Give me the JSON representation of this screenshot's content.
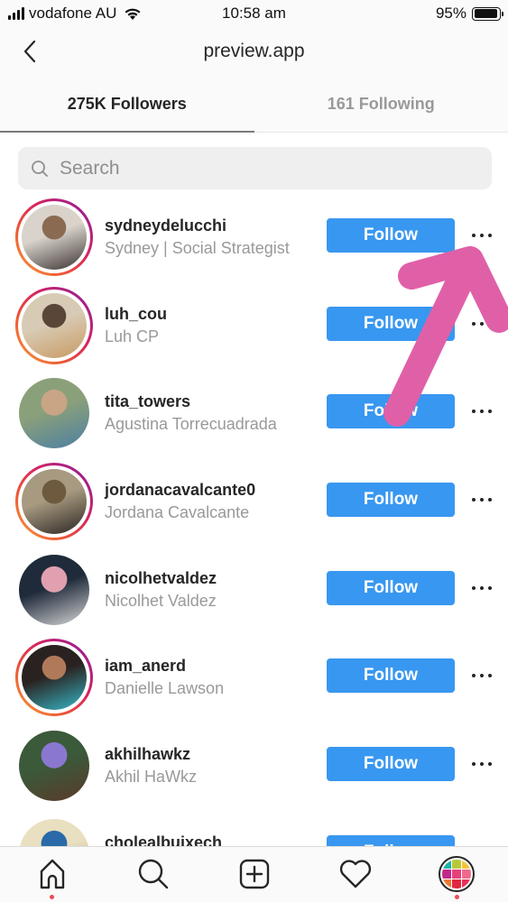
{
  "status_bar": {
    "carrier": "vodafone AU",
    "time": "10:58 am",
    "battery": "95%",
    "battery_level": 0.95
  },
  "nav": {
    "title": "preview.app",
    "back_icon": "chevron-left-icon"
  },
  "tabs": [
    {
      "label": "275K Followers",
      "active": true
    },
    {
      "label": "161 Following",
      "active": false
    }
  ],
  "search": {
    "placeholder": "Search",
    "value": "",
    "icon": "search-icon"
  },
  "follow_label": "Follow",
  "users": [
    {
      "username": "sydneydelucchi",
      "full_name": "Sydney | Social Strategist",
      "has_story": true,
      "avatar_colors": [
        "#d9d3cc",
        "#8a6b52",
        "#3a3230"
      ]
    },
    {
      "username": "luh_cou",
      "full_name": "Luh CP",
      "has_story": true,
      "avatar_colors": [
        "#d8cbb5",
        "#5a4638",
        "#c99a62"
      ]
    },
    {
      "username": "tita_towers",
      "full_name": "Agustina Torrecuadrada",
      "has_story": false,
      "avatar_colors": [
        "#8aa07a",
        "#c9a586",
        "#4c7fa3"
      ]
    },
    {
      "username": "jordanacavalcante0",
      "full_name": "Jordana Cavalcante",
      "has_story": true,
      "avatar_colors": [
        "#a79a80",
        "#6e5a3e",
        "#2c2622"
      ]
    },
    {
      "username": "nicolhetvaldez",
      "full_name": "Nicolhet Valdez",
      "has_story": false,
      "avatar_colors": [
        "#1f2a3a",
        "#e0a0b0",
        "#d8d8d8"
      ]
    },
    {
      "username": "iam_anerd",
      "full_name": "Danielle Lawson",
      "has_story": true,
      "avatar_colors": [
        "#2a2220",
        "#b07a5a",
        "#37b8c8"
      ]
    },
    {
      "username": "akhilhawkz",
      "full_name": "Akhil HaWkz",
      "has_story": false,
      "avatar_colors": [
        "#3a5a3a",
        "#8a78d0",
        "#5a3a2a"
      ]
    },
    {
      "username": "cholealbuixech",
      "full_name": "",
      "has_story": false,
      "avatar_colors": [
        "#e8e0c0",
        "#2a6aa8",
        "#c09070"
      ]
    }
  ],
  "bottom_nav": [
    {
      "name": "home",
      "icon": "home-icon",
      "active": true,
      "notification_dot": true
    },
    {
      "name": "search",
      "icon": "search-icon",
      "active": false,
      "notification_dot": false
    },
    {
      "name": "new-post",
      "icon": "plus-square-icon",
      "active": false,
      "notification_dot": false
    },
    {
      "name": "activity",
      "icon": "heart-icon",
      "active": false,
      "notification_dot": false
    },
    {
      "name": "profile",
      "icon": "profile-avatar",
      "active": true,
      "notification_dot": true
    }
  ],
  "profile_avatar_grid": [
    "#1fb3a8",
    "#b8c83a",
    "#f2c43a",
    "#c2288a",
    "#e8407a",
    "#ef6a8a",
    "#f07a30",
    "#e02840",
    "#e8305a"
  ],
  "colors": {
    "accent": "#3897f0",
    "annotation": "#e060a8",
    "story_ring_start": "#f7a43a",
    "story_ring_end": "#8a2596",
    "notification": "#ed4956"
  }
}
